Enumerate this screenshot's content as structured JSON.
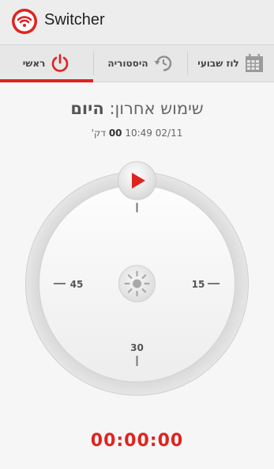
{
  "app": {
    "title": "Switcher",
    "logo_icon": "switcher-wifi-logo-icon"
  },
  "tabs": [
    {
      "label": "ראשי",
      "icon": "power-icon",
      "active": true
    },
    {
      "label": "היסטוריה",
      "icon": "history-icon",
      "active": false
    },
    {
      "label": "לוז שבועי",
      "icon": "calendar-icon",
      "active": false
    }
  ],
  "last_use": {
    "prefix": "שימוש אחרון: ",
    "day": "היום",
    "date": "02/11",
    "time": "10:49",
    "minutes": "00",
    "minutes_unit": "דק'"
  },
  "dial": {
    "label_15": "15",
    "label_30": "30",
    "label_45": "45",
    "center_icon": "brightness-icon",
    "play_icon": "play-icon"
  },
  "timer": "00:00:00",
  "colors": {
    "accent": "#e0231f",
    "appbar": "#ededed",
    "tabbar": "#e7e7e7",
    "background": "#f6f6f6"
  }
}
